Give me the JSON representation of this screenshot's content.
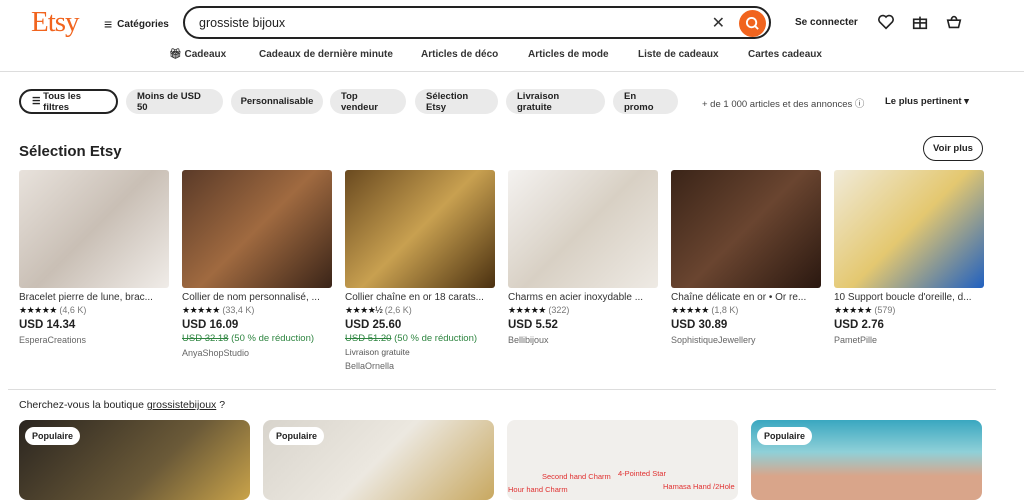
{
  "header": {
    "logo": "Etsy",
    "categories": "Catégories",
    "search_value": "grossiste bijoux",
    "login": "Se connecter"
  },
  "nav": [
    "Cadeaux",
    "Cadeaux de dernière minute",
    "Articles de déco",
    "Articles de mode",
    "Liste de cadeaux",
    "Cartes cadeaux"
  ],
  "filters": {
    "all": "Tous les filtres",
    "chips": [
      "Moins de USD 50",
      "Personnalisable",
      "Top vendeur",
      "Sélection Etsy",
      "Livraison gratuite",
      "En promo"
    ],
    "count": "+ de 1 000 articles et des annonces ⓘ",
    "sort": "Le plus pertinent ▾"
  },
  "section": {
    "title": "Sélection Etsy",
    "more": "Voir plus"
  },
  "products": [
    {
      "title": "Bracelet pierre de lune, brac...",
      "stars": "★★★★★",
      "rating": 5,
      "reviews": "(4,6 K)",
      "price": "USD 14.34",
      "shop": "EsperaCreations"
    },
    {
      "title": "Collier de nom personnalisé, ...",
      "stars": "★★★★★",
      "rating": 5,
      "reviews": "(33,4 K)",
      "price": "USD 16.09",
      "old": "USD 32.18",
      "discount": "(50 % de réduction)",
      "shop": "AnyaShopStudio"
    },
    {
      "title": "Collier chaîne en or 18 carats...",
      "stars": "★★★★½",
      "rating": 4.5,
      "reviews": "(2,6 K)",
      "price": "USD 25.60",
      "old": "USD 51.20",
      "discount": "(50 % de réduction)",
      "free": "Livraison gratuite",
      "shop": "BellaOrnella"
    },
    {
      "title": "Charms en acier inoxydable ...",
      "stars": "★★★★★",
      "rating": 5,
      "reviews": "(322)",
      "price": "USD 5.52",
      "shop": "Bellibijoux"
    },
    {
      "title": "Chaîne délicate en or • Or re...",
      "stars": "★★★★★",
      "rating": 5,
      "reviews": "(1,8 K)",
      "price": "USD 30.89",
      "shop": "SophistiqueJewellery"
    },
    {
      "title": "10 Support boucle d'oreille, d...",
      "stars": "★★★★★",
      "rating": 5,
      "reviews": "(579)",
      "price": "USD 2.76",
      "shop": "PametPille"
    }
  ],
  "shop_query": {
    "prefix": "Cherchez-vous la boutique ",
    "shop": "grossistebijoux",
    "suffix": " ?"
  },
  "shops": [
    {
      "badge": "Populaire"
    },
    {
      "badge": "Populaire"
    },
    {
      "labels": [
        "Second hand Charm",
        "4-Pointed Star",
        "Hour hand Charm",
        "Hamasa Hand /2Hole"
      ]
    },
    {
      "badge": "Populaire"
    }
  ],
  "colors": {
    "accent": "#f1641e",
    "discount": "#2e8540"
  }
}
